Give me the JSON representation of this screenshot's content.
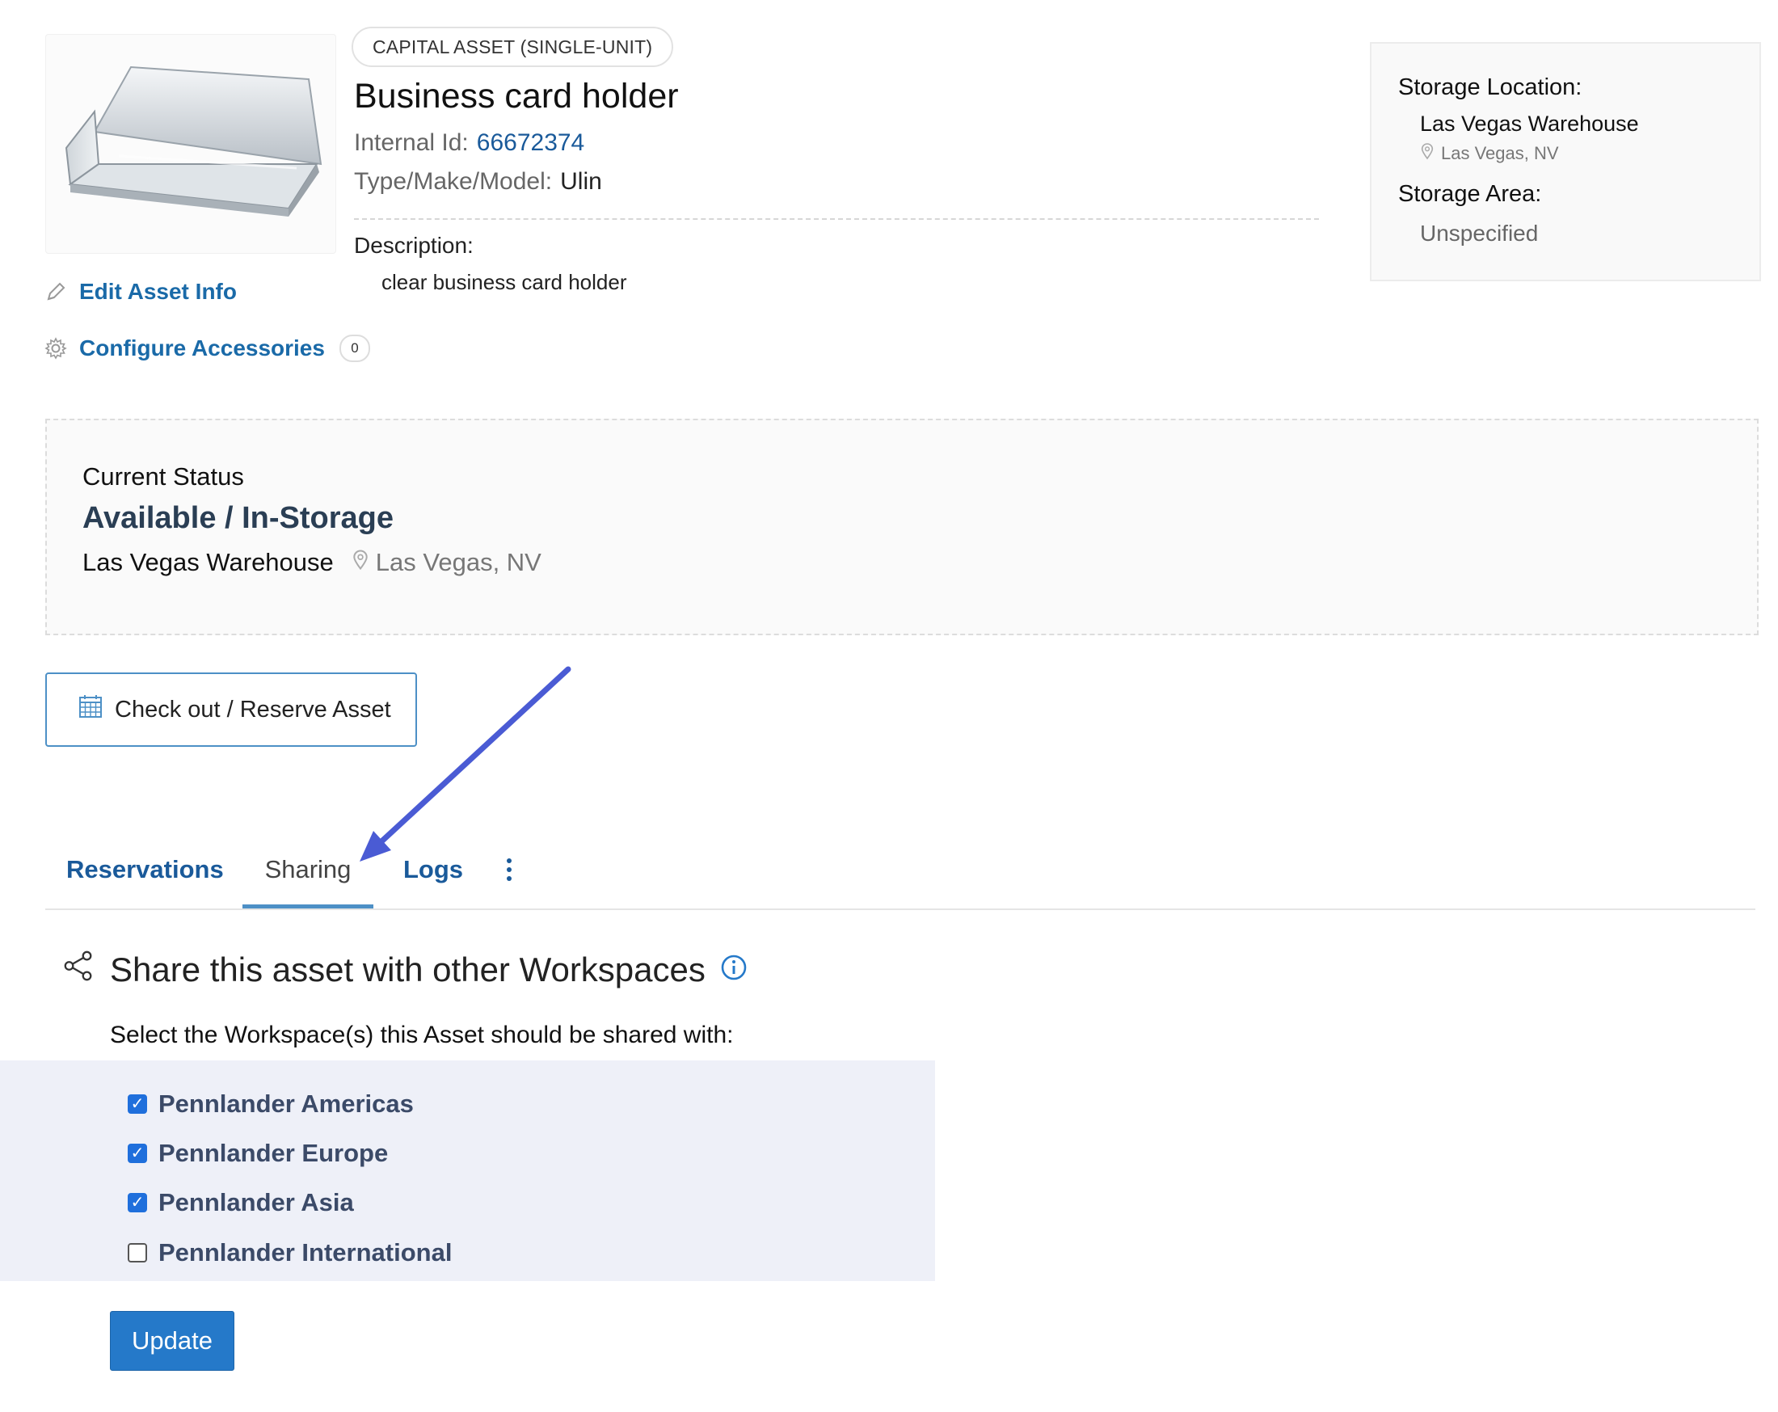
{
  "asset": {
    "type_badge": "CAPITAL ASSET (SINGLE-UNIT)",
    "name": "Business card holder",
    "internal_id_label": "Internal Id:",
    "internal_id": "66672374",
    "tmm_label": "Type/Make/Model:",
    "tmm_value": "Ulin",
    "description_label": "Description:",
    "description": "clear business card holder"
  },
  "actions": {
    "edit_label": "Edit Asset Info",
    "accessories_label": "Configure Accessories",
    "accessories_count": "0"
  },
  "storage": {
    "location_label": "Storage Location:",
    "location_name": "Las Vegas Warehouse",
    "location_city": "Las Vegas, NV",
    "area_label": "Storage Area:",
    "area_value": "Unspecified"
  },
  "status": {
    "label": "Current Status",
    "value": "Available / In-Storage",
    "location_name": "Las Vegas Warehouse",
    "location_city": "Las Vegas, NV"
  },
  "checkout_button": "Check out / Reserve Asset",
  "tabs": [
    {
      "label": "Reservations",
      "active": false
    },
    {
      "label": "Sharing",
      "active": true
    },
    {
      "label": "Logs",
      "active": false
    }
  ],
  "sharing": {
    "title": "Share this asset with other Workspaces",
    "subtitle": "Select the Workspace(s) this Asset should be shared with:",
    "workspaces": [
      {
        "label": "Pennlander Americas",
        "checked": true
      },
      {
        "label": "Pennlander Europe",
        "checked": true
      },
      {
        "label": "Pennlander Asia",
        "checked": true
      },
      {
        "label": "Pennlander International",
        "checked": false
      }
    ],
    "update_label": "Update"
  },
  "colors": {
    "link": "#1a5a9a",
    "primary_button": "#2579c9",
    "annotation_arrow": "#4a5bd4",
    "panel_bg": "#eef0f8"
  }
}
